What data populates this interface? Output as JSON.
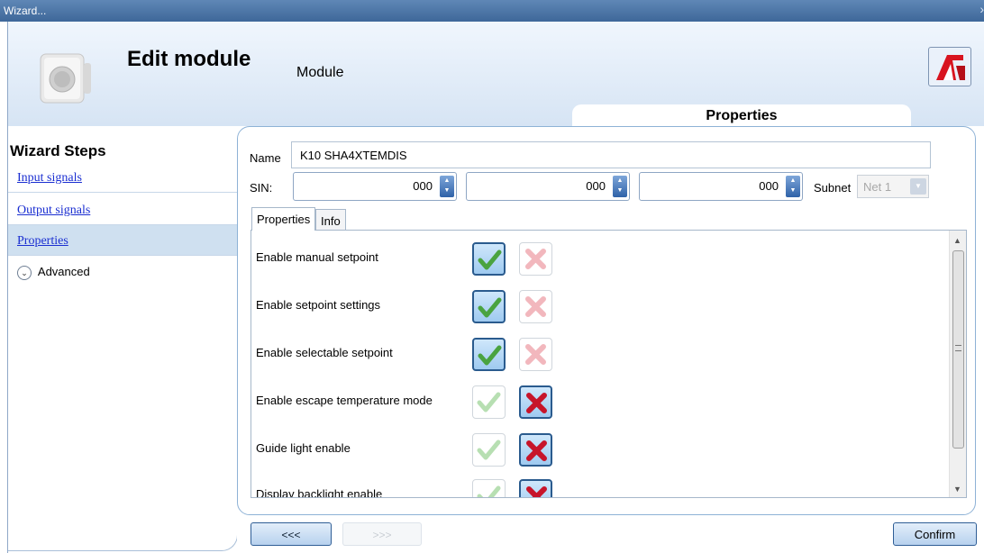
{
  "window": {
    "title": "Wizard..."
  },
  "header": {
    "title": "Edit module",
    "subtitle": "Module",
    "active_section": "Properties"
  },
  "wizard_steps": {
    "title": "Wizard Steps",
    "items": [
      {
        "label": "Input signals"
      },
      {
        "label": "Output signals"
      },
      {
        "label": "Properties",
        "active": true
      },
      {
        "label": "Advanced"
      }
    ]
  },
  "form": {
    "name_label": "Name",
    "name_value": "K10 SHA4XTEMDIS",
    "sin_label": "SIN:",
    "sin_values": [
      "000",
      "000",
      "000"
    ],
    "subnet_label": "Subnet",
    "subnet_value": "Net 1"
  },
  "tabs": [
    {
      "label": "Properties",
      "active": true
    },
    {
      "label": "Info"
    }
  ],
  "properties": [
    {
      "label": "Enable manual setpoint",
      "enabled": true
    },
    {
      "label": "Enable setpoint settings",
      "enabled": true
    },
    {
      "label": "Enable selectable setpoint",
      "enabled": true
    },
    {
      "label": "Enable escape temperature mode",
      "enabled": false
    },
    {
      "label": "Guide light enable",
      "enabled": false
    },
    {
      "label": "Display backlight enable",
      "enabled": false
    }
  ],
  "buttons": {
    "back": "<<<",
    "next": ">>>",
    "confirm": "Confirm"
  },
  "colors": {
    "titlebar": "#3e6799",
    "link": "#1a2ed1",
    "check_green": "#4aa340",
    "cross_red": "#c7142a"
  }
}
